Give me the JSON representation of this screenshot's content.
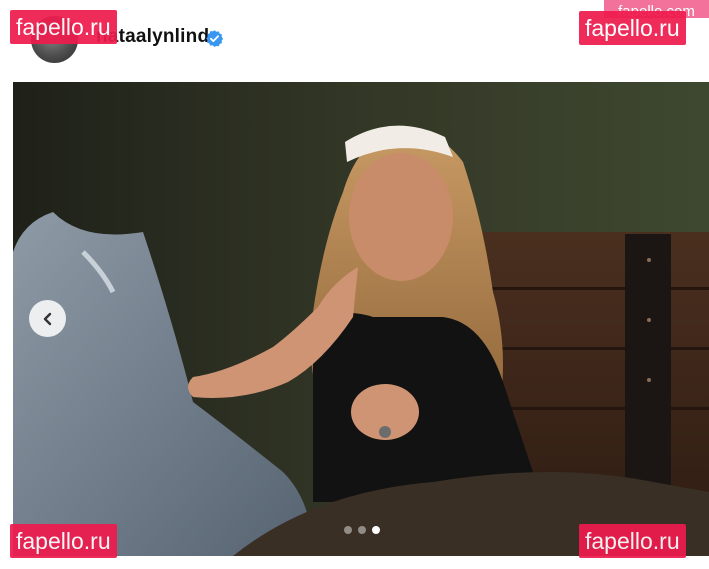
{
  "post": {
    "username": "nataalynlind",
    "verified": true
  },
  "carousel": {
    "slide_count": 3,
    "active_index": 2
  },
  "watermarks": {
    "top_left": "fapello.ru",
    "top_right": "fapello.ru",
    "bottom_left": "fapello.ru",
    "bottom_right": "fapello.ru",
    "corner": "fapello.com"
  },
  "colors": {
    "verified_badge": "#3897f0",
    "watermark_bg": "#ee1b4d"
  },
  "icons": {
    "prev": "chevron-left-icon",
    "verified": "verified-badge-icon"
  }
}
